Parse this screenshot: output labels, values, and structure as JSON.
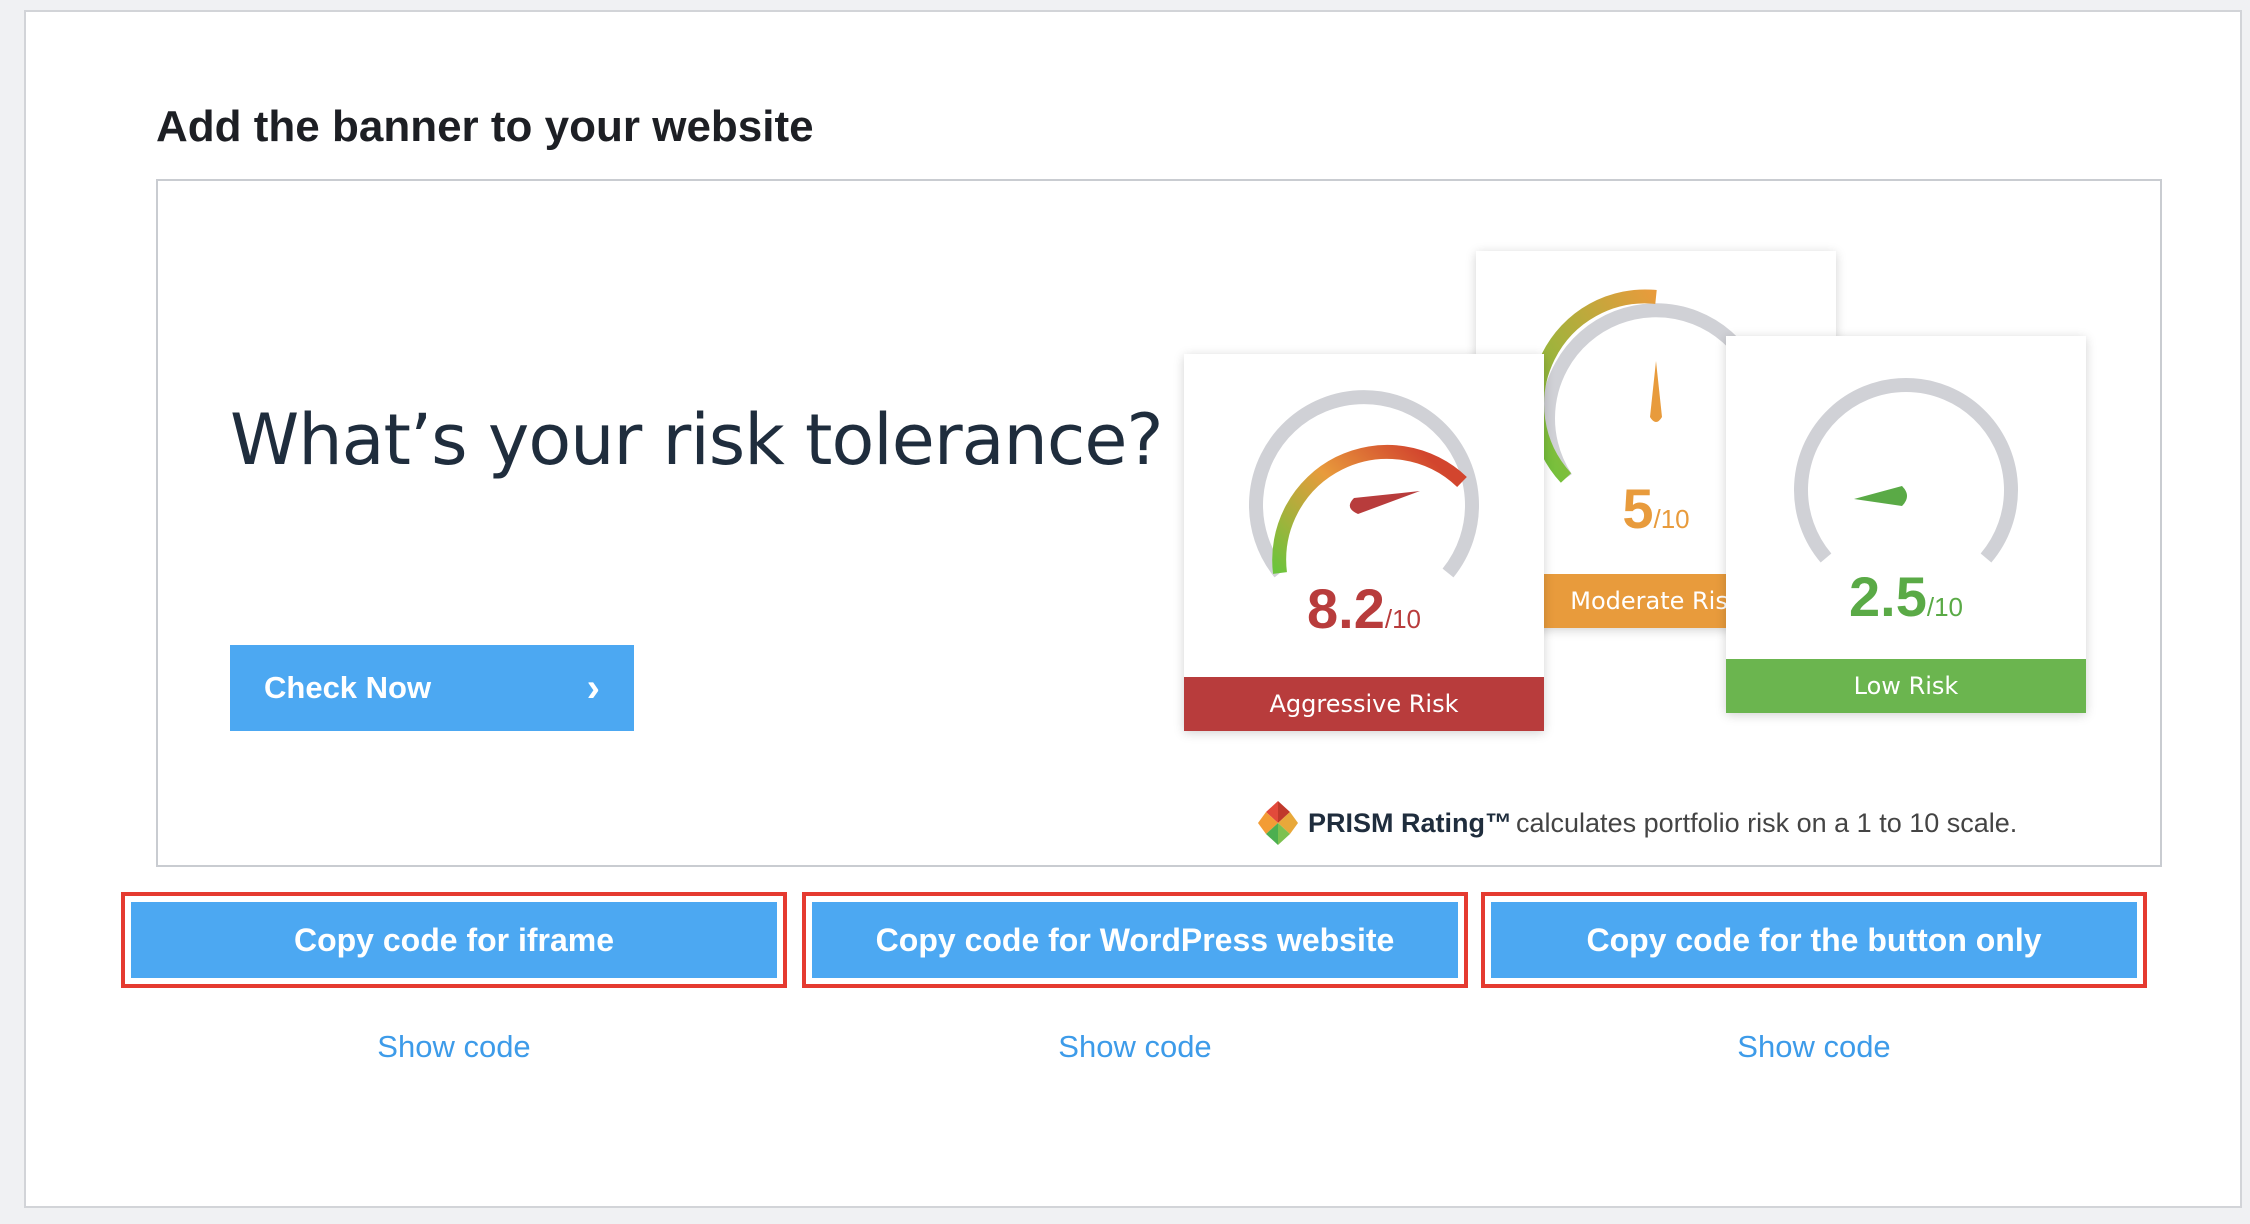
{
  "heading": "Add the banner to your website",
  "banner": {
    "question": "What’s your risk tolerance?",
    "check_button": "Check Now",
    "cards": [
      {
        "score": "5",
        "denominator": "/10",
        "label": "Moderate Risk",
        "value": 5,
        "color": "#e89b3c"
      },
      {
        "score": "2.5",
        "denominator": "/10",
        "label": "Low Risk",
        "value": 2.5,
        "color": "#5aaa46"
      },
      {
        "score": "8.2",
        "denominator": "/10",
        "label": "Aggressive Risk",
        "value": 8.2,
        "color": "#b83c3c"
      }
    ],
    "prism_brand": "PRISM Rating™",
    "prism_text": "calculates portfolio risk on a 1 to 10 scale."
  },
  "buttons": [
    {
      "label": "Copy code for iframe",
      "link": "Show code"
    },
    {
      "label": "Copy code for WordPress website",
      "link": "Show code"
    },
    {
      "label": "Copy code for the button only",
      "link": "Show code"
    }
  ],
  "colors": {
    "accent": "#4ca8f2",
    "highlight": "#e53a30"
  }
}
